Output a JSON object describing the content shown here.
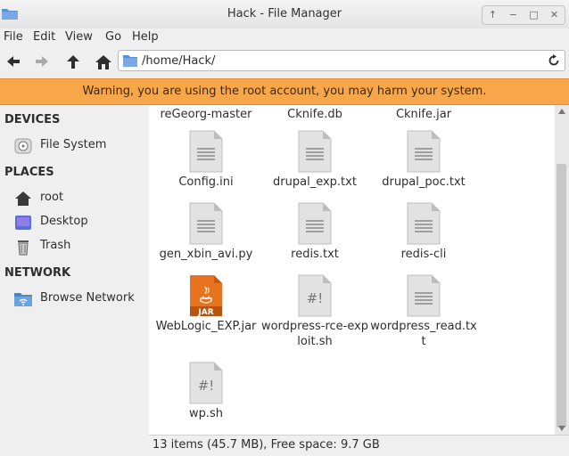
{
  "window": {
    "title": "Hack - File Manager",
    "controls": [
      "↑",
      "−",
      "□",
      "✕"
    ]
  },
  "menu": [
    "File",
    "Edit",
    "View",
    "Go",
    "Help"
  ],
  "location": {
    "path": "/home/Hack/"
  },
  "warning": "Warning, you are using the root account, you may harm your system.",
  "sidebar": {
    "devices": {
      "heading": "DEVICES",
      "items": [
        {
          "label": "File System",
          "icon": "drive-icon"
        }
      ]
    },
    "places": {
      "heading": "PLACES",
      "items": [
        {
          "label": "root",
          "icon": "home-icon"
        },
        {
          "label": "Desktop",
          "icon": "desktop-icon"
        },
        {
          "label": "Trash",
          "icon": "trash-icon"
        }
      ]
    },
    "network": {
      "heading": "NETWORK",
      "items": [
        {
          "label": "Browse Network",
          "icon": "network-icon"
        }
      ]
    }
  },
  "files": [
    {
      "name": "reGeorg-master",
      "type": "partial"
    },
    {
      "name": "Cknife.db",
      "type": "partial"
    },
    {
      "name": "Cknife.jar",
      "type": "partial"
    },
    {
      "name": "Config.ini",
      "type": "text"
    },
    {
      "name": "drupal_exp.txt",
      "type": "text"
    },
    {
      "name": "drupal_poc.txt",
      "type": "text"
    },
    {
      "name": "gen_xbin_avi.py",
      "type": "text"
    },
    {
      "name": "redis.txt",
      "type": "text"
    },
    {
      "name": "redis-cli",
      "type": "text"
    },
    {
      "name": "WebLogic_EXP.jar",
      "type": "jar",
      "badge": "JAR"
    },
    {
      "name": "wordpress-rce-exploit.sh",
      "type": "script",
      "badge": "#!"
    },
    {
      "name": "wordpress_read.txt",
      "type": "text"
    },
    {
      "name": "wp.sh",
      "type": "script",
      "badge": "#!"
    }
  ],
  "status": "13 items (45.7 MB), Free space: 9.7 GB",
  "colors": {
    "warning": "#f8a64a",
    "jar": "#e8731e",
    "folder": "#5a8fd6"
  }
}
